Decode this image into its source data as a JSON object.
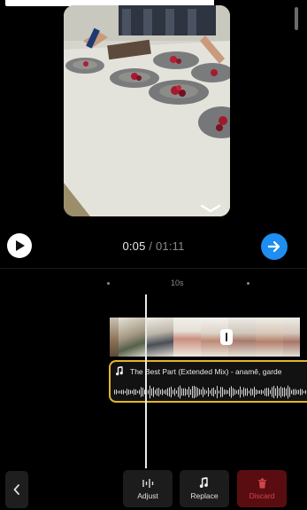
{
  "player": {
    "current_time": "0:05",
    "separator": " / ",
    "total_time": "01:11"
  },
  "timeline": {
    "ruler_label": "10s"
  },
  "audio": {
    "title": "The Best Part (Extended Mix) - anamê, garde"
  },
  "toolbar": {
    "adjust_label": "Adjust",
    "replace_label": "Replace",
    "discard_label": "Discard"
  },
  "colors": {
    "accent_blue": "#1e8ef0",
    "audio_border": "#e2b52a",
    "discard_bg": "#5a0d10",
    "discard_text": "#d2464a"
  },
  "icons": {
    "play": "play-icon",
    "next": "arrow-right-icon",
    "collapse": "chevron-down-icon",
    "music": "music-note-icon",
    "adjust": "sliders-icon",
    "replace": "music-note-icon",
    "discard": "trash-icon",
    "back": "chevron-left-icon"
  }
}
